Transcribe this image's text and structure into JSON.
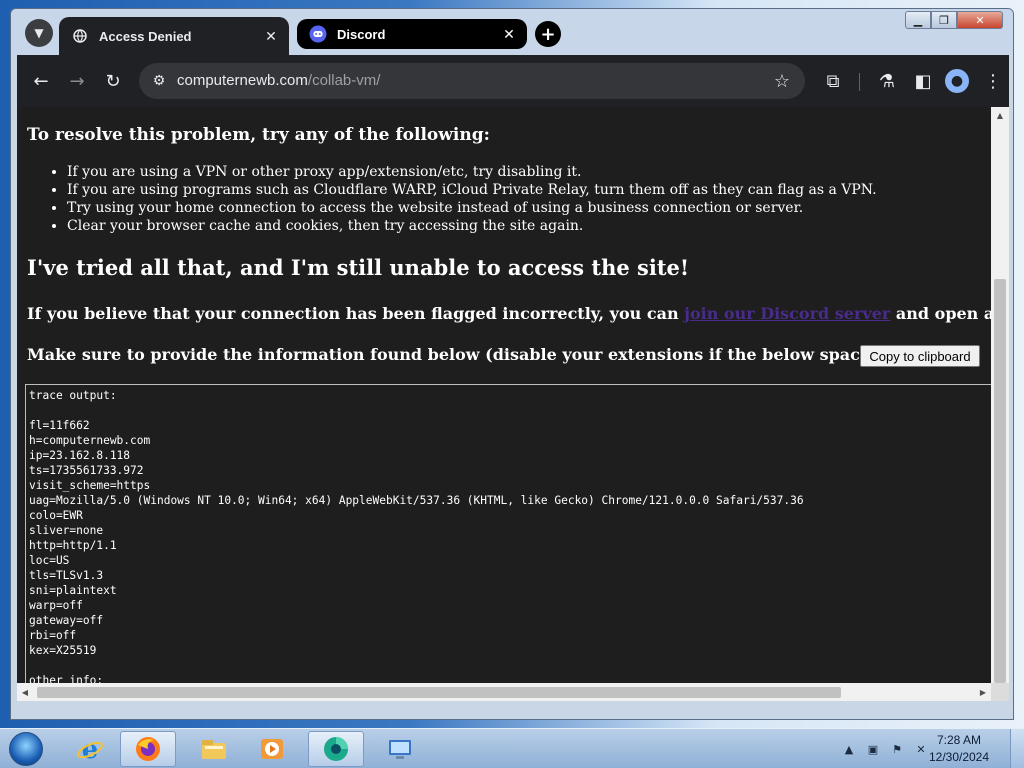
{
  "browser": {
    "tabs": [
      {
        "title": "Access Denied",
        "active": true
      },
      {
        "title": "Discord",
        "active": false
      }
    ],
    "new_tab_label": "+",
    "url_host": "computernewb.com",
    "url_path": "/collab-vm/"
  },
  "page": {
    "resolve_heading": "To resolve this problem, try any of the following:",
    "resolve_items": [
      "If you are using a VPN or other proxy app/extension/etc, try disabling it.",
      "If you are using programs such as Cloudflare WARP, iCloud Private Relay, turn them off as they can flag as a VPN.",
      "Try using your home connection to access the website instead of using a business connection or server.",
      "Clear your browser cache and cookies, then try accessing the site again."
    ],
    "tried_heading": "I've tried all that, and I'm still unable to access the site!",
    "flagged_prefix": "If you believe that your connection has been flagged incorrectly, you can ",
    "flagged_link": "join our Discord server",
    "flagged_suffix": " and open a ticket.",
    "provide_text": "Make sure to provide the information found below (disable your extensions if the below space is empty):",
    "copy_button": "Copy to clipboard",
    "trace_text": "trace output:\n\nfl=11f662\nh=computernewb.com\nip=23.162.8.118\nts=1735561733.972\nvisit_scheme=https\nuag=Mozilla/5.0 (Windows NT 10.0; Win64; x64) AppleWebKit/537.36 (KHTML, like Gecko) Chrome/121.0.0.0 Safari/537.36\ncolo=EWR\nsliver=none\nhttp=http/1.1\nloc=US\ntls=TLSv1.3\nsni=plaintext\nwarp=off\ngateway=off\nrbi=off\nkex=X25519\n\nother info:"
  },
  "taskbar": {
    "time": "7:28 AM",
    "date": "12/30/2024"
  },
  "colors": {
    "page_bg": "#1e1e1e",
    "link": "#4a2b8c",
    "chrome_dark": "#202124"
  }
}
